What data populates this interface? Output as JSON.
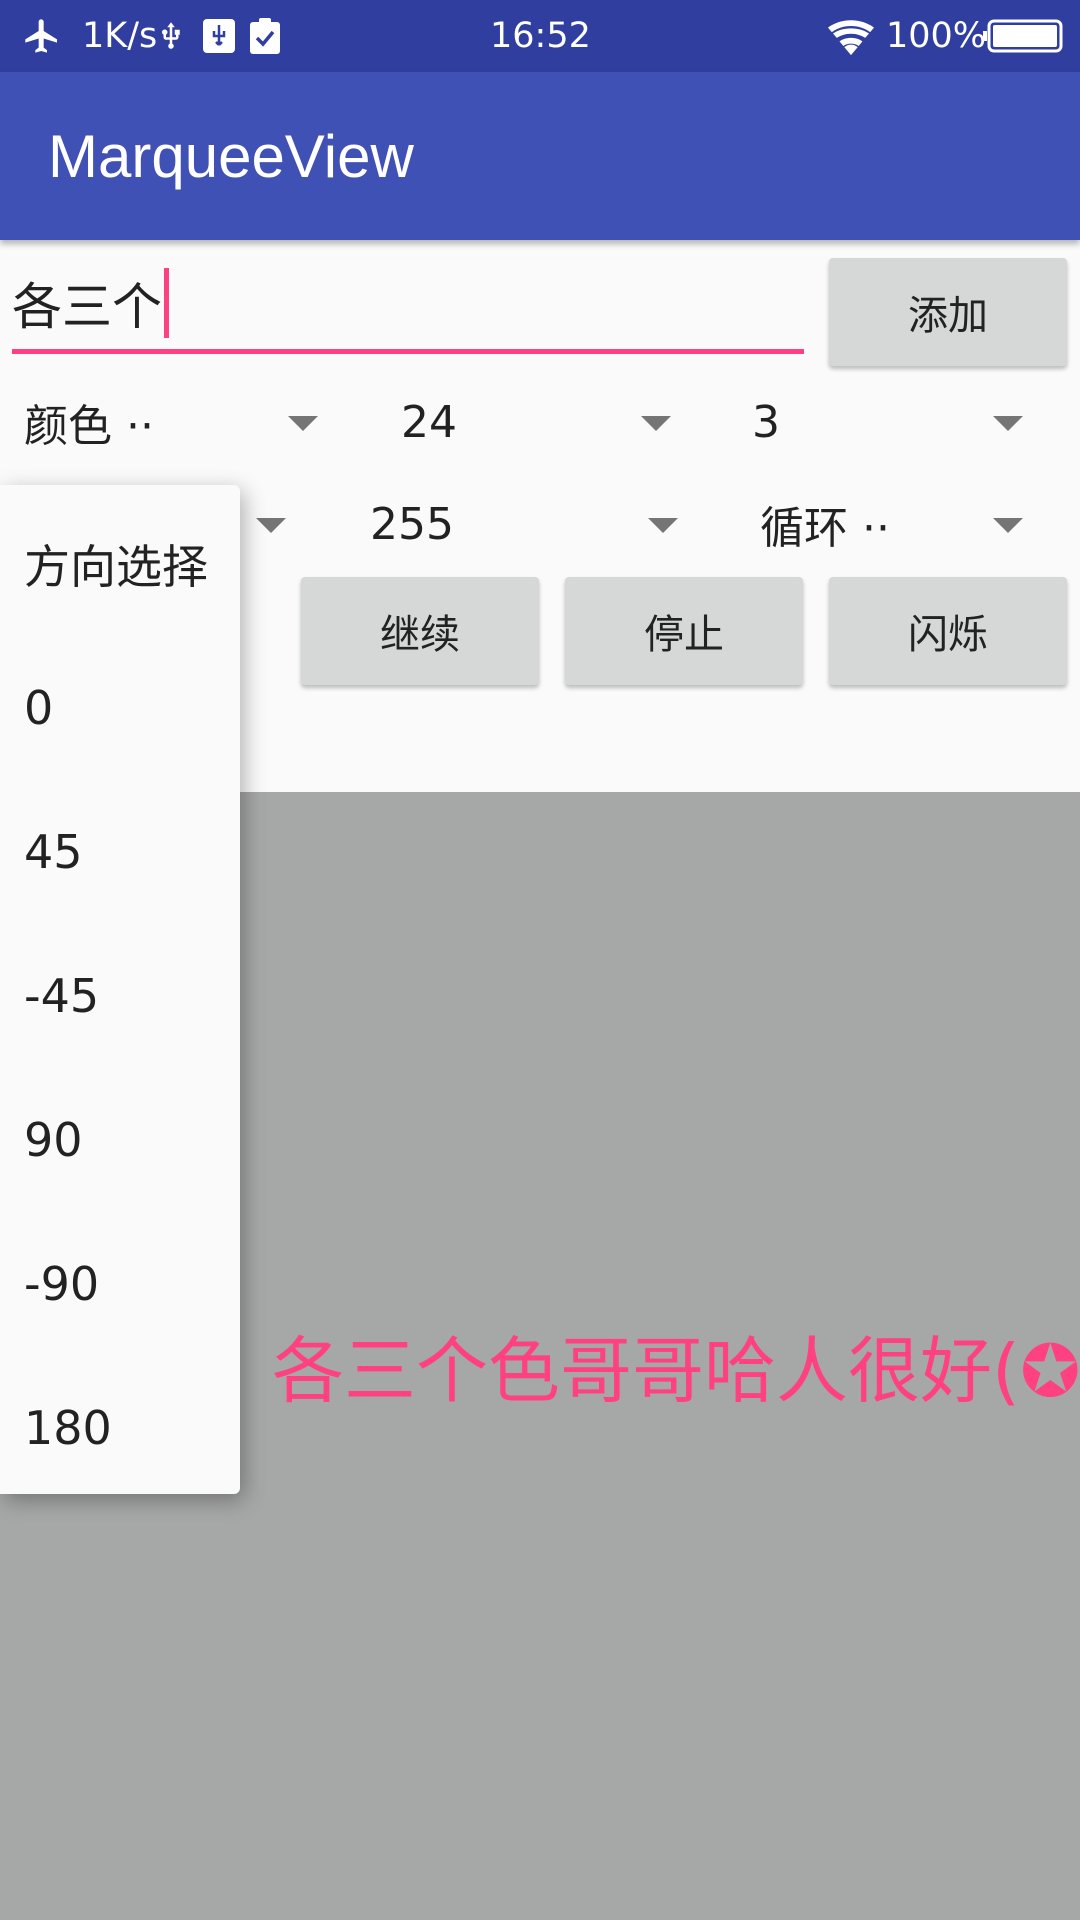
{
  "status_bar": {
    "speed": "1K/s",
    "time": "16:52",
    "battery": "100%",
    "icons": [
      "airplane-icon",
      "usb-icon",
      "usb-debug-icon",
      "clipboard-check-icon",
      "wifi-icon",
      "battery-icon"
    ]
  },
  "app_bar": {
    "title": "MarqueeView"
  },
  "input": {
    "value": "各三个"
  },
  "buttons": {
    "add": "添加",
    "continue": "继续",
    "stop": "停止",
    "blink": "闪烁"
  },
  "spinners": {
    "color": "颜色 ··",
    "size": "24",
    "speed": "3",
    "alpha": "255",
    "mode": "循环 ··"
  },
  "dropdown": {
    "items": [
      "方向选择",
      "0",
      "45",
      "-45",
      "90",
      "-90",
      "180"
    ]
  },
  "marquee": {
    "text": "各三个色哥哥哈人很好(✪"
  },
  "colors": {
    "status_bar": "#303f9f",
    "primary": "#3f51b5",
    "accent": "#ff4081",
    "marquee_bg": "#a6a7a7",
    "button_bg": "#d6d7d7"
  }
}
